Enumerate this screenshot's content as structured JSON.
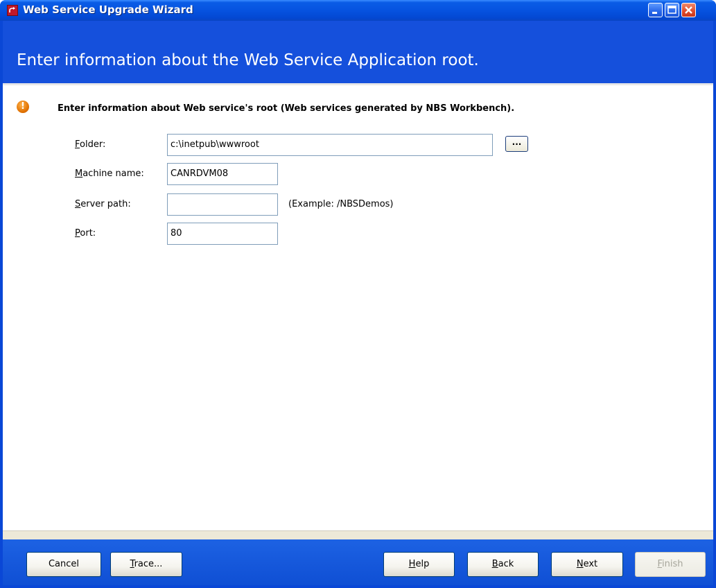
{
  "window": {
    "title": "Web Service Upgrade Wizard"
  },
  "header": {
    "text": "Enter information about the Web Service Application root."
  },
  "info": {
    "text": "Enter information about Web service's root (Web services generated by NBS Workbench)."
  },
  "form": {
    "folder": {
      "label_first": "F",
      "label_rest": "older:",
      "value": "c:\\inetpub\\wwwroot",
      "browse_label": "..."
    },
    "machine": {
      "label_first": "M",
      "label_rest": "achine name:",
      "value": "CANRDVM08"
    },
    "server_path": {
      "label_first": "S",
      "label_rest": "erver path:",
      "value": "",
      "example": "(Example: /NBSDemos)"
    },
    "port": {
      "label_first": "P",
      "label_rest": "ort:",
      "value": "80"
    }
  },
  "buttons": {
    "cancel": "Cancel",
    "trace_first": "T",
    "trace_rest": "race...",
    "help_first": "H",
    "help_rest": "elp",
    "back_first": "B",
    "back_rest": "ack",
    "next_first": "N",
    "next_rest": "ext",
    "finish_first": "F",
    "finish_rest": "inish"
  },
  "colors": {
    "titlebar": "#0653e0",
    "header": "#1550dc",
    "close_button": "#de4a2b"
  }
}
